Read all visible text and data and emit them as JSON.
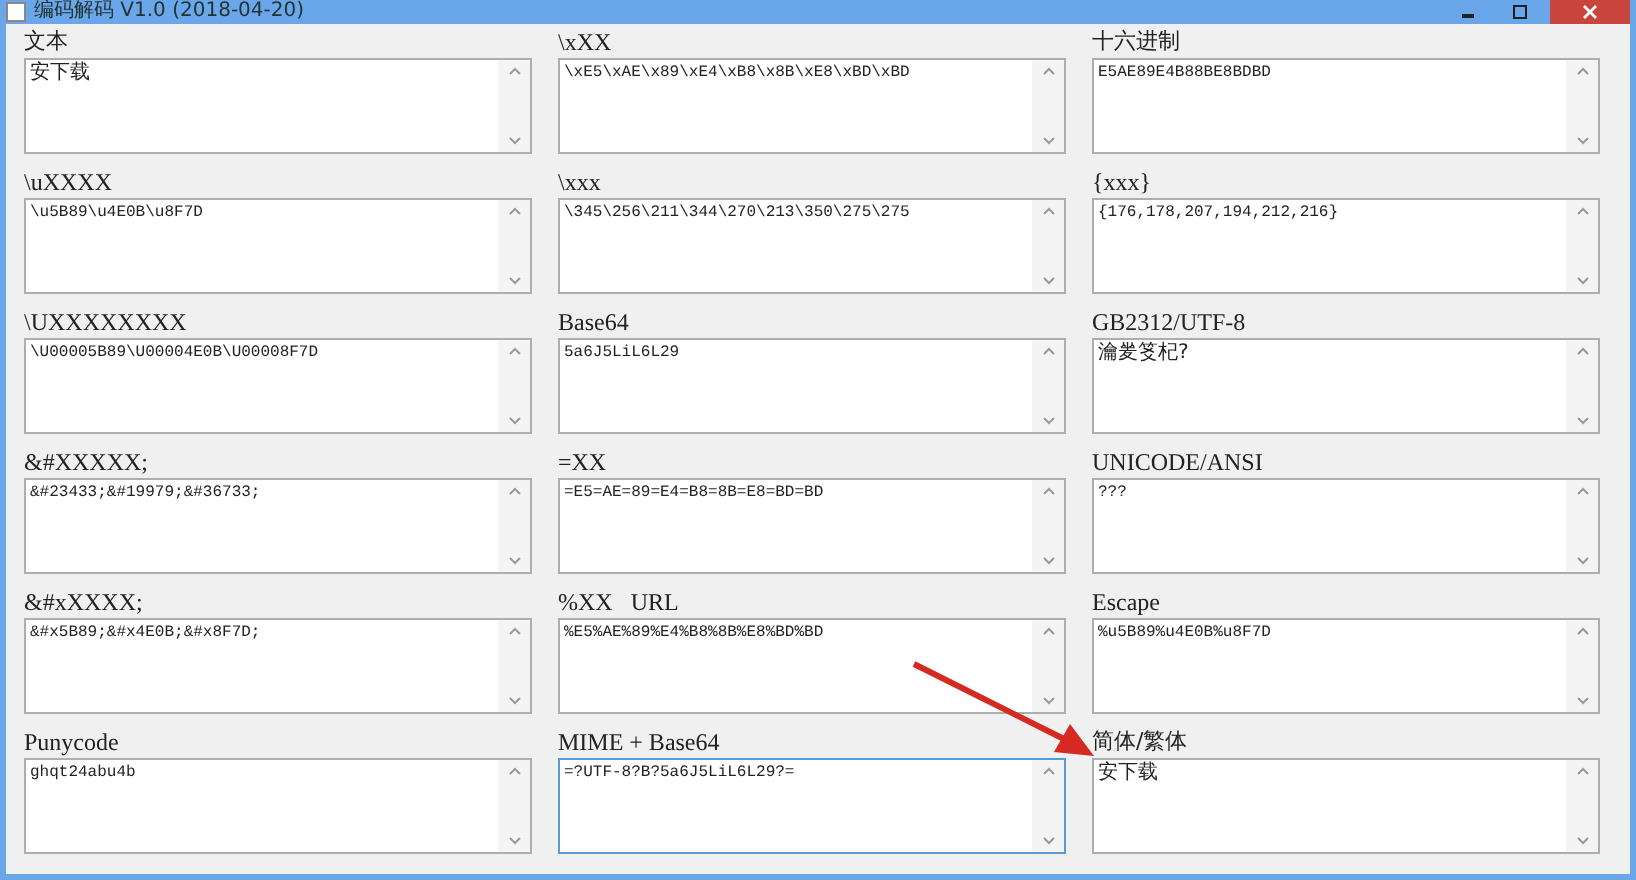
{
  "window": {
    "title": "编码解码 V1.0  (2018-04-20)"
  },
  "fields": [
    {
      "label": "文本",
      "value": "安下载",
      "focused": false
    },
    {
      "label": "\\xXX",
      "value": "\\xE5\\xAE\\x89\\xE4\\xB8\\x8B\\xE8\\xBD\\xBD",
      "focused": false
    },
    {
      "label": "十六进制",
      "value": "E5AE89E4B88BE8BDBD",
      "focused": false
    },
    {
      "label": "\\uXXXX",
      "value": "\\u5B89\\u4E0B\\u8F7D",
      "focused": false
    },
    {
      "label": "\\xxx",
      "value": "\\345\\256\\211\\344\\270\\213\\350\\275\\275",
      "focused": false
    },
    {
      "label": "{xxx}",
      "value": "{176,178,207,194,212,216}",
      "focused": false
    },
    {
      "label": "\\UXXXXXXXX",
      "value": "\\U00005B89\\U00004E0B\\U00008F7D",
      "focused": false
    },
    {
      "label": "Base64",
      "value": "5a6J5LiL6L29",
      "focused": false
    },
    {
      "label": "GB2312/UTF-8",
      "value": "瀹夎笅杞?",
      "focused": false
    },
    {
      "label": "&#XXXXX;",
      "value": "&#23433;&#19979;&#36733;",
      "focused": false
    },
    {
      "label": "=XX",
      "value": "=E5=AE=89=E4=B8=8B=E8=BD=BD",
      "focused": false
    },
    {
      "label": "UNICODE/ANSI",
      "value": "???",
      "focused": false
    },
    {
      "label": "&#xXXXX;",
      "value": "&#x5B89;&#x4E0B;&#x8F7D;",
      "focused": false
    },
    {
      "label": "%XX   URL",
      "value": "%E5%AE%89%E4%B8%8B%E8%BD%BD",
      "focused": false
    },
    {
      "label": "Escape",
      "value": "%u5B89%u4E0B%u8F7D",
      "focused": false
    },
    {
      "label": "Punycode",
      "value": "ghqt24abu4b",
      "focused": false
    },
    {
      "label": "MIME + Base64",
      "value": "=?UTF-8?B?5a6J5LiL6L29?=",
      "focused": true
    },
    {
      "label": "简体/繁体",
      "value": "安下载",
      "focused": false
    }
  ]
}
